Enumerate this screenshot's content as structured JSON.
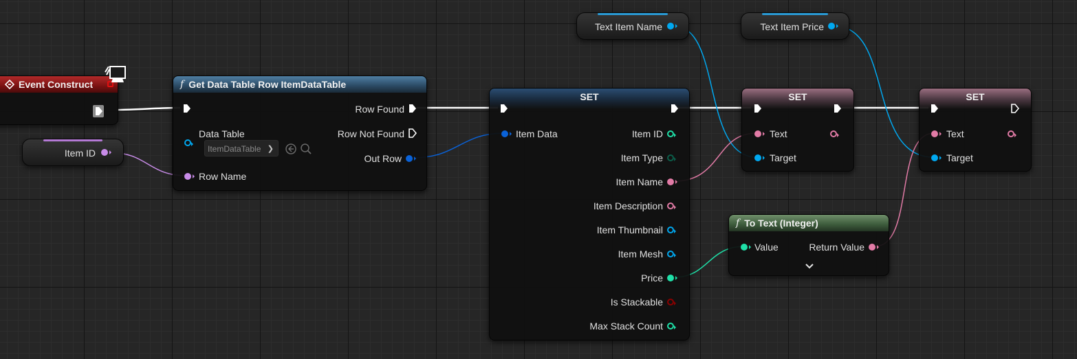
{
  "colors": {
    "exec": "#ffffff",
    "object_blue": "#00a8f0",
    "struct_blue": "#0a62d8",
    "text_pink": "#e27ba6",
    "name_violet": "#c88ce8",
    "integer_green": "#1fe0a8",
    "bool_red": "#8c0000",
    "event_red": "#9b1b1b"
  },
  "event_node": {
    "title": "Event Construct",
    "icon": "diamond-event-icon",
    "badge_icon": "monitor-icon"
  },
  "item_id_var": {
    "label": "Item ID"
  },
  "get_row_node": {
    "title": "Get Data Table Row ItemDataTable",
    "icon": "function-icon",
    "pins": {
      "data_table": "Data Table",
      "row_name": "Row Name",
      "row_found": "Row Found",
      "row_not_found": "Row Not Found",
      "out_row": "Out Row"
    },
    "dropdown_value": "ItemDataTable"
  },
  "set_struct_node": {
    "title": "SET",
    "input": "Item Data",
    "outputs": [
      "Item ID",
      "Item Type",
      "Item Name",
      "Item Description",
      "Item Thumbnail",
      "Item Mesh",
      "Price",
      "Is Stackable",
      "Max Stack Count"
    ]
  },
  "text_item_name_var": {
    "label": "Text Item Name"
  },
  "text_item_price_var": {
    "label": "Text Item Price"
  },
  "set_name_node": {
    "title": "SET",
    "text": "Text",
    "target": "Target"
  },
  "set_price_node": {
    "title": "SET",
    "text": "Text",
    "target": "Target"
  },
  "to_text_node": {
    "title": "To Text (Integer)",
    "icon": "function-icon",
    "value": "Value",
    "return_value": "Return Value",
    "expand_icon": "chevron-down-icon"
  }
}
